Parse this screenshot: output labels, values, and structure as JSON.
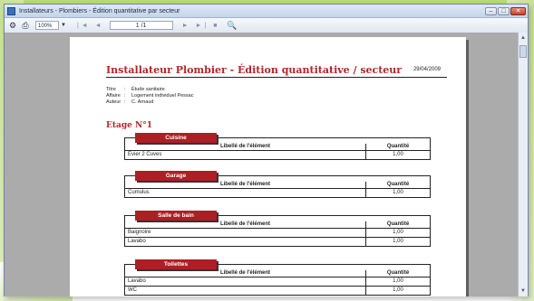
{
  "window": {
    "title": "Installateurs - Plombiers - Édition quantitative par secteur",
    "btn_minimize": "–",
    "btn_maximize": "□",
    "btn_close": "✕"
  },
  "toolbar": {
    "zoom": "100%",
    "first_page": "|◄",
    "prev_page": "◄",
    "page_indicator": "1 /1",
    "next_page": "►",
    "last_page": "►|",
    "stop": "■",
    "print_icon": "printer-icon",
    "setup_icon": "print-setup-icon",
    "search_icon": "binoculars-icon"
  },
  "report": {
    "title": "Installateur Plombier - Édition quantitative / secteur",
    "date": "29/04/2009",
    "meta": [
      {
        "key": "Titre",
        "sep": ":",
        "value": "Étude sanitaire"
      },
      {
        "key": "Affaire",
        "sep": ":",
        "value": "Logement individuel Pessac"
      },
      {
        "key": "Auteur",
        "sep": ":",
        "value": "C. Arnaud"
      }
    ],
    "etage": "Etage N°1",
    "col_label": "Libellé de l'élément",
    "col_qty": "Quantité",
    "sections": [
      {
        "name": "Cuisine",
        "rows": [
          {
            "label": "Evier 2 Cuves",
            "qty": "1,00"
          }
        ]
      },
      {
        "name": "Garage",
        "rows": [
          {
            "label": "Cumulus",
            "qty": "1,00"
          }
        ]
      },
      {
        "name": "Salle de bain",
        "rows": [
          {
            "label": "Baignoire",
            "qty": "1,00"
          },
          {
            "label": "Lavabo",
            "qty": "1,00"
          }
        ]
      },
      {
        "name": "Toilettes",
        "rows": [
          {
            "label": "Lavabo",
            "qty": "1,00"
          },
          {
            "label": "WC",
            "qty": "1,00"
          }
        ]
      }
    ]
  },
  "colors": {
    "accent": "#ad1f24",
    "title": "#b0282a",
    "background_frame": "#b9d97a"
  }
}
